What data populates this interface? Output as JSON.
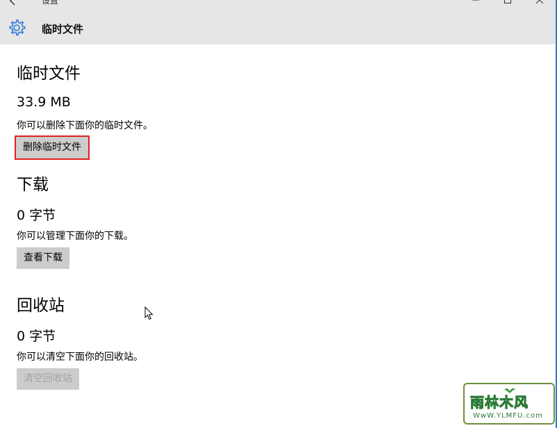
{
  "window": {
    "title": "设置",
    "page_name": "临时文件"
  },
  "sections": [
    {
      "heading": "临时文件",
      "size": "33.9 MB",
      "description": "你可以删除下面你的临时文件。",
      "button_label": "删除临时文件"
    },
    {
      "heading": "下载",
      "size": "0 字节",
      "description": "你可以管理下面你的下载。",
      "button_label": "查看下载"
    },
    {
      "heading": "回收站",
      "size": "0 字节",
      "description": "你可以清空下面你的回收站。",
      "button_label": "清空回收站"
    }
  ],
  "watermark": {
    "main": "雨林木风",
    "sub": "WwW.YLMFU.com"
  },
  "colors": {
    "accent": "#2b78d6",
    "highlight": "#e02020",
    "button_bg": "#cccccc",
    "disabled_text": "#a2a2a2"
  }
}
